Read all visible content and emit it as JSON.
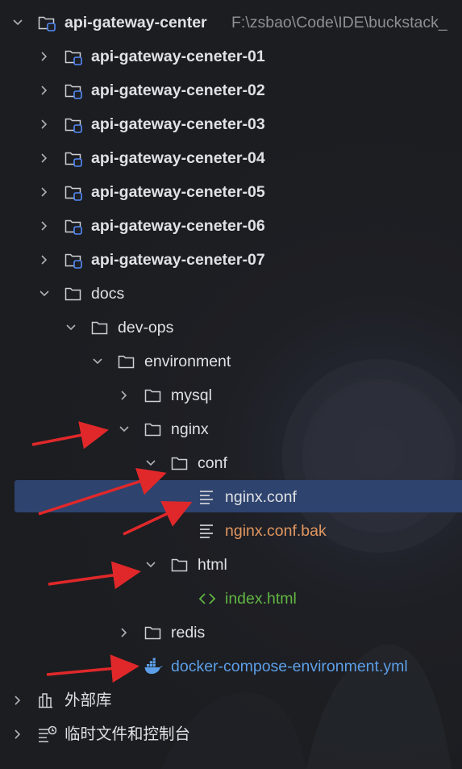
{
  "tree": {
    "root": {
      "name": "api-gateway-center",
      "path": "F:\\zsbao\\Code\\IDE\\buckstack_"
    },
    "modules": [
      "api-gateway-ceneter-01",
      "api-gateway-ceneter-02",
      "api-gateway-ceneter-03",
      "api-gateway-ceneter-04",
      "api-gateway-ceneter-05",
      "api-gateway-ceneter-06",
      "api-gateway-ceneter-07"
    ],
    "docs": "docs",
    "devops": "dev-ops",
    "environment": "environment",
    "mysql": "mysql",
    "nginx": "nginx",
    "conf": "conf",
    "nginx_conf": "nginx.conf",
    "nginx_conf_bak": "nginx.conf.bak",
    "html": "html",
    "index_html": "index.html",
    "redis": "redis",
    "docker_compose": "docker-compose-environment.yml",
    "external_libs": "外部库",
    "scratches": "临时文件和控制台"
  },
  "colors": {
    "selection": "#2e436e",
    "text": "#dfe1e5",
    "path": "#8c8f94",
    "orange_file": "#e0965f",
    "green_file": "#62b543",
    "blue_file": "#5c9fe8",
    "annotation_arrow": "#e0282a"
  },
  "icons": {
    "folder": "folder-icon",
    "module": "module-folder-icon",
    "text_file": "text-file-icon",
    "html_file": "html-file-icon",
    "docker": "docker-icon",
    "libraries": "libraries-icon",
    "scratches": "scratches-icon"
  }
}
